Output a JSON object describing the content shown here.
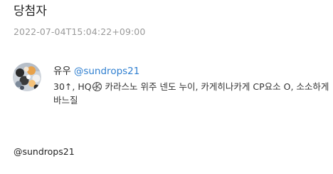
{
  "page": {
    "title": "당첨자",
    "timestamp": "2022-07-04T15:04:22+09:00"
  },
  "entry": {
    "name": "유우",
    "handle": "@sundrops21",
    "text_before_icon": "30↑, HQ",
    "icon": "volleyball-icon",
    "text_after_icon": " 카라스노 위주 넨도 누이, 카게히나카게 CP요소 O, 소소하게 바느질"
  },
  "footer": {
    "handle": "@sundrops21"
  },
  "colors": {
    "link": "#2f7fd0",
    "muted": "#9a9a9a",
    "text": "#222222"
  }
}
